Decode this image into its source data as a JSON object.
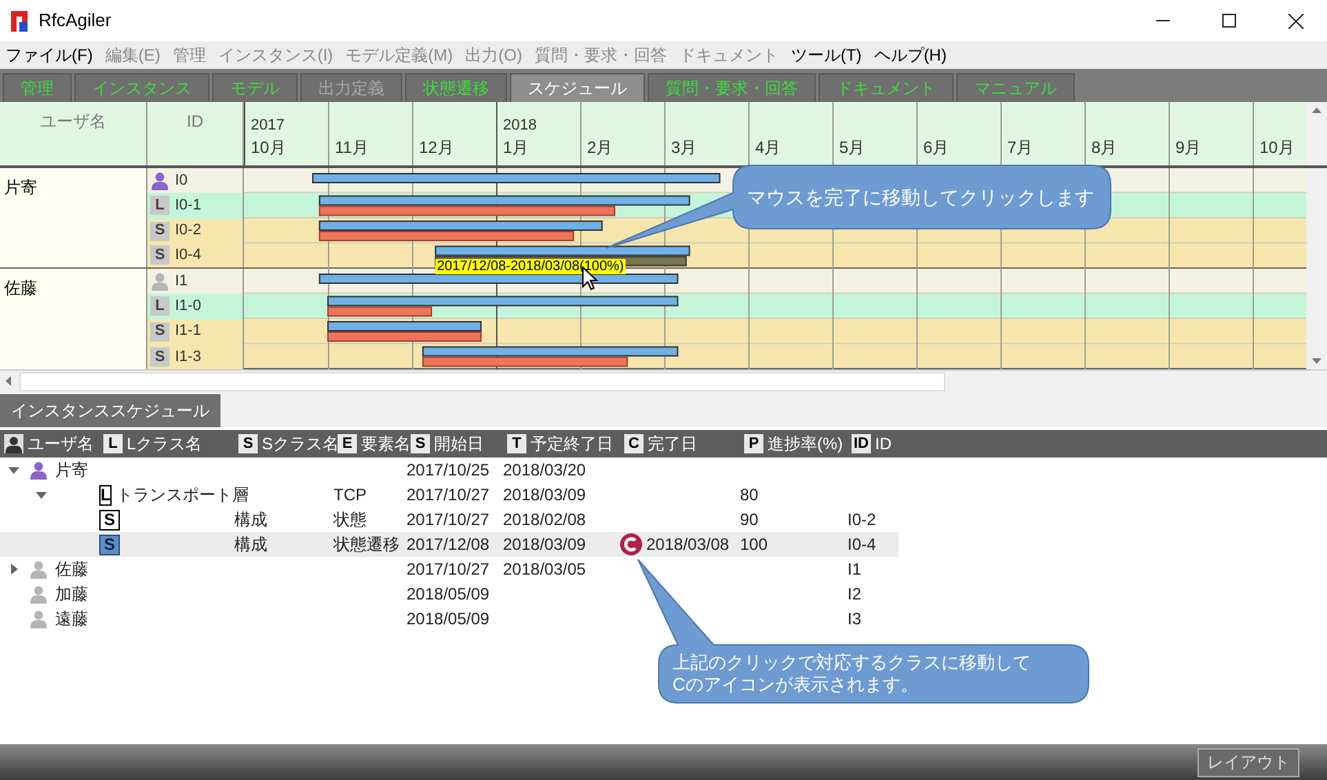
{
  "window": {
    "title": "RfcAgiler"
  },
  "menu": [
    {
      "label": "ファイル(F)",
      "disabled": false
    },
    {
      "label": "編集(E)",
      "disabled": true
    },
    {
      "label": "管理",
      "disabled": true
    },
    {
      "label": "インスタンス(I)",
      "disabled": true
    },
    {
      "label": "モデル定義(M)",
      "disabled": true
    },
    {
      "label": "出力(O)",
      "disabled": true
    },
    {
      "label": "質問・要求・回答",
      "disabled": true
    },
    {
      "label": "ドキュメント",
      "disabled": true
    },
    {
      "label": "ツール(T)",
      "disabled": false
    },
    {
      "label": "ヘルプ(H)",
      "disabled": false
    }
  ],
  "tabs": [
    {
      "label": "管理",
      "selected": false,
      "disabled": false
    },
    {
      "label": "インスタンス",
      "selected": false,
      "disabled": false
    },
    {
      "label": "モデル",
      "selected": false,
      "disabled": false
    },
    {
      "label": "出力定義",
      "selected": false,
      "disabled": true
    },
    {
      "label": "状態遷移",
      "selected": false,
      "disabled": false
    },
    {
      "label": "スケジュール",
      "selected": true,
      "disabled": false
    },
    {
      "label": "質問・要求・回答",
      "selected": false,
      "disabled": false
    },
    {
      "label": "ドキュメント",
      "selected": false,
      "disabled": false
    },
    {
      "label": "マニュアル",
      "selected": false,
      "disabled": false
    }
  ],
  "gantt": {
    "columns": [
      "ユーザ名",
      "ID"
    ],
    "months": [
      {
        "year": "2017",
        "label": "10月"
      },
      {
        "label": "11月"
      },
      {
        "label": "12月"
      },
      {
        "year": "2018",
        "label": "1月"
      },
      {
        "label": "2月"
      },
      {
        "label": "3月"
      },
      {
        "label": "4月"
      },
      {
        "label": "5月"
      },
      {
        "label": "6月"
      },
      {
        "label": "7月"
      },
      {
        "label": "8月"
      },
      {
        "label": "9月"
      },
      {
        "label": "10月"
      }
    ],
    "groups": [
      {
        "user": "片寄",
        "rows": [
          {
            "kind": "user",
            "color": "#8a64c8",
            "id": "I0"
          },
          {
            "kind": "class",
            "badge": "L",
            "id": "I0-1",
            "done": false
          },
          {
            "kind": "class",
            "badge": "S",
            "id": "I0-2",
            "done": false
          },
          {
            "kind": "class",
            "badge": "S",
            "id": "I0-4",
            "done": true,
            "tooltip": "2017/12/08-2018/03/08(100%)"
          }
        ]
      },
      {
        "user": "佐藤",
        "rows": [
          {
            "kind": "user",
            "color": "#b4b4b4",
            "id": "I1"
          },
          {
            "kind": "class",
            "badge": "L",
            "id": "I1-0",
            "done": false
          },
          {
            "kind": "class",
            "badge": "S",
            "id": "I1-1",
            "done": false
          },
          {
            "kind": "class",
            "badge": "S",
            "id": "I1-3",
            "done": false
          }
        ]
      }
    ]
  },
  "callouts": [
    {
      "lines": [
        "マウスを完了に移動してクリックします"
      ]
    },
    {
      "lines": [
        "上記のクリックで対応するクラスに移動して",
        "Cのアイコンが表示されます。"
      ]
    }
  ],
  "schedule_panel": {
    "tab": "インスタンススケジュール",
    "columns": [
      {
        "kind": "person",
        "label": "ユーザ名"
      },
      {
        "kind": "badge",
        "badge": "L",
        "label": "Lクラス名"
      },
      {
        "kind": "badge",
        "badge": "S",
        "label": "Sクラス名"
      },
      {
        "kind": "badge",
        "badge": "E",
        "label": "要素名"
      },
      {
        "kind": "badge",
        "badge": "S",
        "label": "開始日"
      },
      {
        "kind": "badge",
        "badge": "T",
        "label": "予定終了日"
      },
      {
        "kind": "badge",
        "badge": "C",
        "label": "完了日"
      },
      {
        "kind": "badge",
        "badge": "P",
        "label": "進捗率(%)"
      },
      {
        "kind": "badge",
        "badge": "ID",
        "label": "ID"
      }
    ],
    "rows": [
      {
        "kind": "user",
        "name": "片寄",
        "color": "#8a64c8",
        "expanded": true,
        "selected": false,
        "start": "2017/10/25",
        "end": "2018/03/20",
        "children": [
          {
            "kind": "class",
            "badge": "L",
            "lclass": "トランスポート層",
            "element": "TCP",
            "expanded": true,
            "selected": false,
            "start": "2017/10/27",
            "end": "2018/03/09",
            "progress": "80",
            "children": [
              {
                "kind": "class",
                "badge": "S",
                "sclass": "構成",
                "element": "状態",
                "selected": false,
                "start": "2017/10/27",
                "end": "2018/02/08",
                "progress": "90",
                "id": "I0-2"
              },
              {
                "kind": "class",
                "badge": "S",
                "sclass": "構成",
                "element": "状態遷移",
                "selected": true,
                "start": "2017/12/08",
                "end": "2018/03/09",
                "completed": "2018/03/08",
                "progress": "100",
                "id": "I0-4"
              }
            ]
          }
        ]
      },
      {
        "kind": "user",
        "name": "佐藤",
        "color": "#b4b4b4",
        "expanded": false,
        "selected": false,
        "start": "2017/10/27",
        "end": "2018/03/05",
        "id": "I1"
      },
      {
        "kind": "user",
        "name": "加藤",
        "color": "#b4b4b4",
        "selected": false,
        "start": "2018/05/09",
        "id": "I2"
      },
      {
        "kind": "user",
        "name": "遠藤",
        "color": "#b4b4b4",
        "selected": false,
        "start": "2018/05/09",
        "id": "I3"
      }
    ]
  },
  "status_bar": {
    "button": "レイアウト"
  }
}
